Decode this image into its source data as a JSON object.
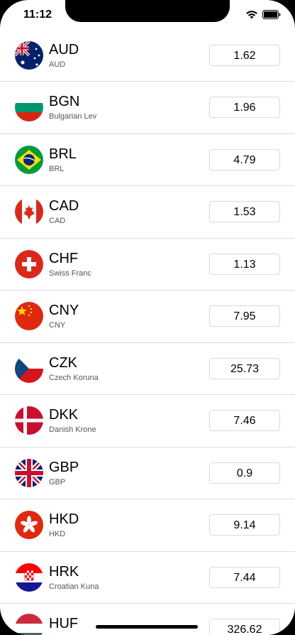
{
  "status_bar": {
    "time": "11:12"
  },
  "currencies": [
    {
      "code": "AUD",
      "name": "AUD",
      "rate": "1.62",
      "flag": "australia-flag-icon"
    },
    {
      "code": "BGN",
      "name": "Bulgarian Lev",
      "rate": "1.96",
      "flag": "bulgaria-flag-icon"
    },
    {
      "code": "BRL",
      "name": "BRL",
      "rate": "4.79",
      "flag": "brazil-flag-icon"
    },
    {
      "code": "CAD",
      "name": "CAD",
      "rate": "1.53",
      "flag": "canada-flag-icon"
    },
    {
      "code": "CHF",
      "name": "Swiss Franc",
      "rate": "1.13",
      "flag": "switzerland-flag-icon"
    },
    {
      "code": "CNY",
      "name": "CNY",
      "rate": "7.95",
      "flag": "china-flag-icon"
    },
    {
      "code": "CZK",
      "name": "Czech Koruna",
      "rate": "25.73",
      "flag": "czechia-flag-icon"
    },
    {
      "code": "DKK",
      "name": "Danish Krone",
      "rate": "7.46",
      "flag": "denmark-flag-icon"
    },
    {
      "code": "GBP",
      "name": "GBP",
      "rate": "0.9",
      "flag": "uk-flag-icon"
    },
    {
      "code": "HKD",
      "name": "HKD",
      "rate": "9.14",
      "flag": "hong-kong-flag-icon"
    },
    {
      "code": "HRK",
      "name": "Croatian Kuna",
      "rate": "7.44",
      "flag": "croatia-flag-icon"
    },
    {
      "code": "HUF",
      "name": "",
      "rate": "326.62",
      "flag": "hungary-flag-icon"
    }
  ]
}
